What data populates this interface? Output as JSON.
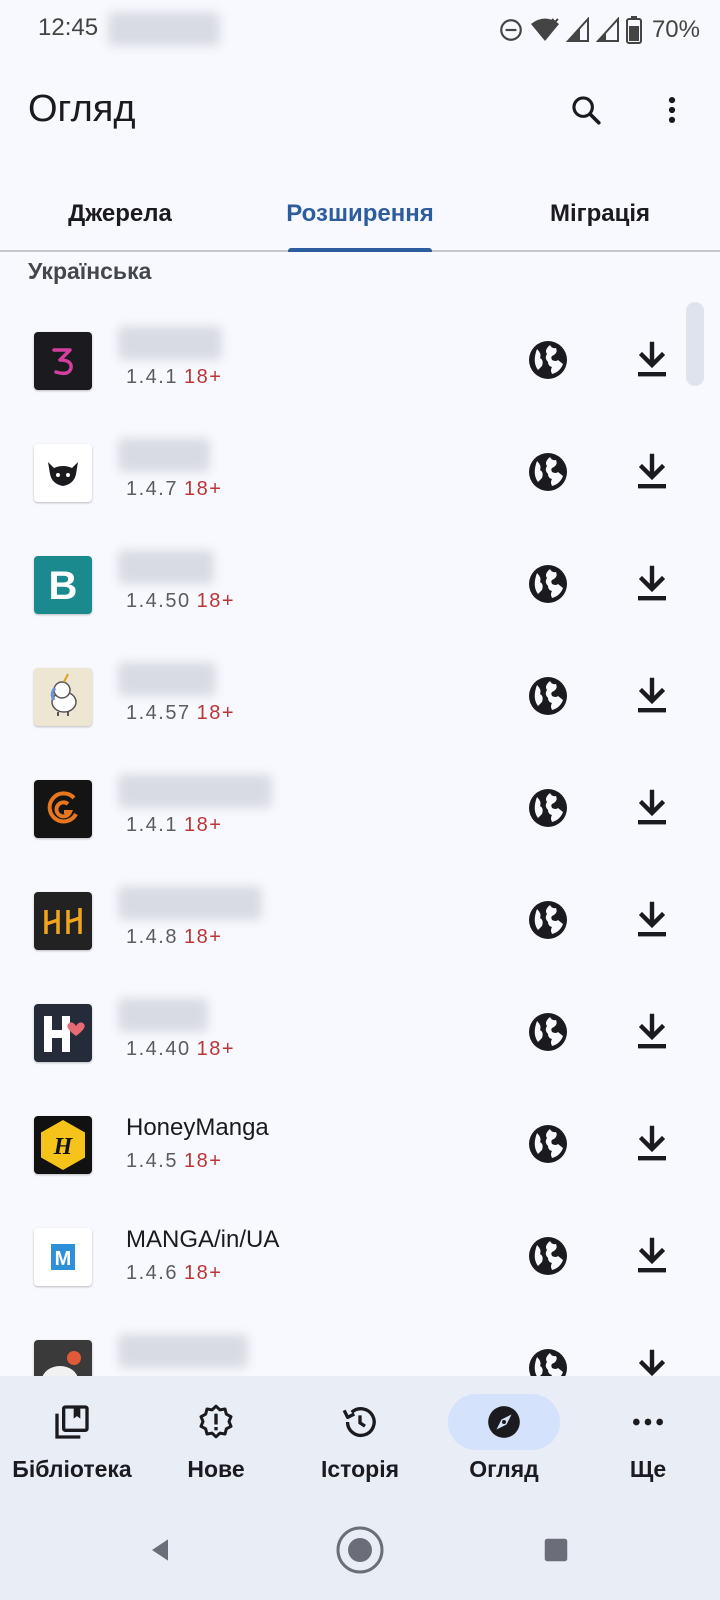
{
  "status_bar": {
    "time": "12:45",
    "battery": "70%"
  },
  "app_bar": {
    "title": "Огляд",
    "search_icon": "search-icon",
    "more_icon": "more-vert-icon"
  },
  "tabs": [
    {
      "label": "Джерела",
      "active": false
    },
    {
      "label": "Розширення",
      "active": true
    },
    {
      "label": "Міграція",
      "active": false
    }
  ],
  "section": {
    "language": "Українська"
  },
  "extensions": [
    {
      "name": "",
      "name_hidden": true,
      "version": "1.4.1",
      "nsfw": "18+"
    },
    {
      "name": "",
      "name_hidden": true,
      "version": "1.4.7",
      "nsfw": "18+"
    },
    {
      "name": "",
      "name_hidden": true,
      "version": "1.4.50",
      "nsfw": "18+"
    },
    {
      "name": "",
      "name_hidden": true,
      "version": "1.4.57",
      "nsfw": "18+"
    },
    {
      "name": "",
      "name_hidden": true,
      "version": "1.4.1",
      "nsfw": "18+"
    },
    {
      "name": "",
      "name_hidden": true,
      "version": "1.4.8",
      "nsfw": "18+"
    },
    {
      "name": "",
      "name_hidden": true,
      "version": "1.4.40",
      "nsfw": "18+"
    },
    {
      "name": "HoneyManga",
      "name_hidden": false,
      "version": "1.4.5",
      "nsfw": "18+"
    },
    {
      "name": "MANGA/in/UA",
      "name_hidden": false,
      "version": "1.4.6",
      "nsfw": "18+"
    },
    {
      "name": "",
      "name_hidden": true,
      "version": "",
      "nsfw": ""
    }
  ],
  "bottom_nav": [
    {
      "label": "Бібліотека",
      "icon": "library-icon",
      "active": false
    },
    {
      "label": "Нове",
      "icon": "updates-icon",
      "active": false
    },
    {
      "label": "Історія",
      "icon": "history-icon",
      "active": false
    },
    {
      "label": "Огляд",
      "icon": "compass-icon",
      "active": true
    },
    {
      "label": "Ще",
      "icon": "more-horiz-icon",
      "active": false
    }
  ],
  "colors": {
    "accent": "#2d5d9c",
    "nsfw": "#ba3535",
    "nav_active_pill": "#d4e2fb"
  }
}
